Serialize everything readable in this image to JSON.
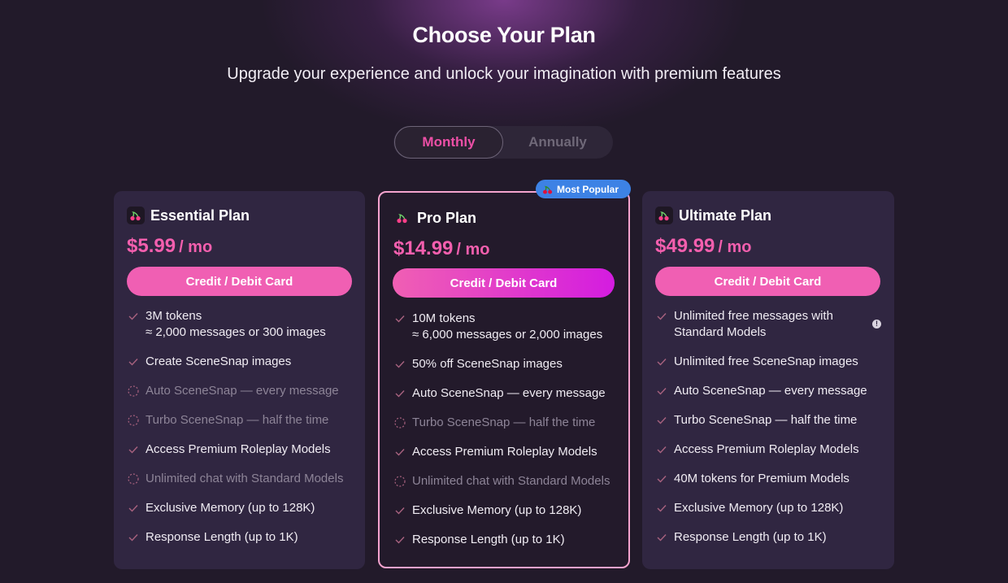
{
  "header": {
    "title": "Choose Your Plan",
    "subtitle": "Upgrade your experience and unlock your imagination with premium features"
  },
  "billing_toggle": {
    "options": [
      "Monthly",
      "Annually"
    ],
    "selected": "Monthly"
  },
  "badge": {
    "label": "Most Popular",
    "icon": "cherry-icon",
    "color": "#3d82e5"
  },
  "colors": {
    "accent": "#f05fb3",
    "price": "#f45fae",
    "card": "#302641",
    "pro_border": "#f5a3ce"
  },
  "plans": [
    {
      "name": "Essential Plan",
      "price": "$5.99",
      "period": "/ mo",
      "button": "Credit / Debit Card",
      "features": [
        {
          "line1": "3M tokens",
          "line2": "≈ 2,000 messages or 300 images",
          "included": true
        },
        {
          "line1": "Create SceneSnap images",
          "included": true
        },
        {
          "line1": "Auto SceneSnap — every message",
          "included": false
        },
        {
          "line1": "Turbo SceneSnap — half the time",
          "included": false
        },
        {
          "line1": "Access Premium Roleplay Models",
          "included": true
        },
        {
          "line1": "Unlimited chat with Standard Models",
          "included": false
        },
        {
          "line1": "Exclusive Memory (up to 128K)",
          "included": true
        },
        {
          "line1": "Response Length (up to 1K)",
          "included": true
        }
      ]
    },
    {
      "name": "Pro Plan",
      "price": "$14.99",
      "period": "/ mo",
      "button": "Credit / Debit Card",
      "features": [
        {
          "line1": "10M tokens",
          "line2": "≈ 6,000 messages or 2,000 images",
          "included": true
        },
        {
          "line1": "50% off SceneSnap images",
          "included": true
        },
        {
          "line1": "Auto SceneSnap — every message",
          "included": true
        },
        {
          "line1": "Turbo SceneSnap — half the time",
          "included": false
        },
        {
          "line1": "Access Premium Roleplay Models",
          "included": true
        },
        {
          "line1": "Unlimited chat with Standard Models",
          "included": false
        },
        {
          "line1": "Exclusive Memory (up to 128K)",
          "included": true
        },
        {
          "line1": "Response Length (up to 1K)",
          "included": true
        }
      ]
    },
    {
      "name": "Ultimate Plan",
      "price": "$49.99",
      "period": "/ mo",
      "button": "Credit / Debit Card",
      "features": [
        {
          "line1": "Unlimited free messages with",
          "line2": "Standard Models",
          "included": true,
          "info": "!"
        },
        {
          "line1": "Unlimited free SceneSnap images",
          "included": true
        },
        {
          "line1": "Auto SceneSnap — every message",
          "included": true
        },
        {
          "line1": "Turbo SceneSnap — half the time",
          "included": true
        },
        {
          "line1": "Access Premium Roleplay Models",
          "included": true
        },
        {
          "line1": "40M tokens for Premium Models",
          "included": true
        },
        {
          "line1": "Exclusive Memory (up to 128K)",
          "included": true
        },
        {
          "line1": "Response Length (up to 1K)",
          "included": true
        }
      ]
    }
  ]
}
